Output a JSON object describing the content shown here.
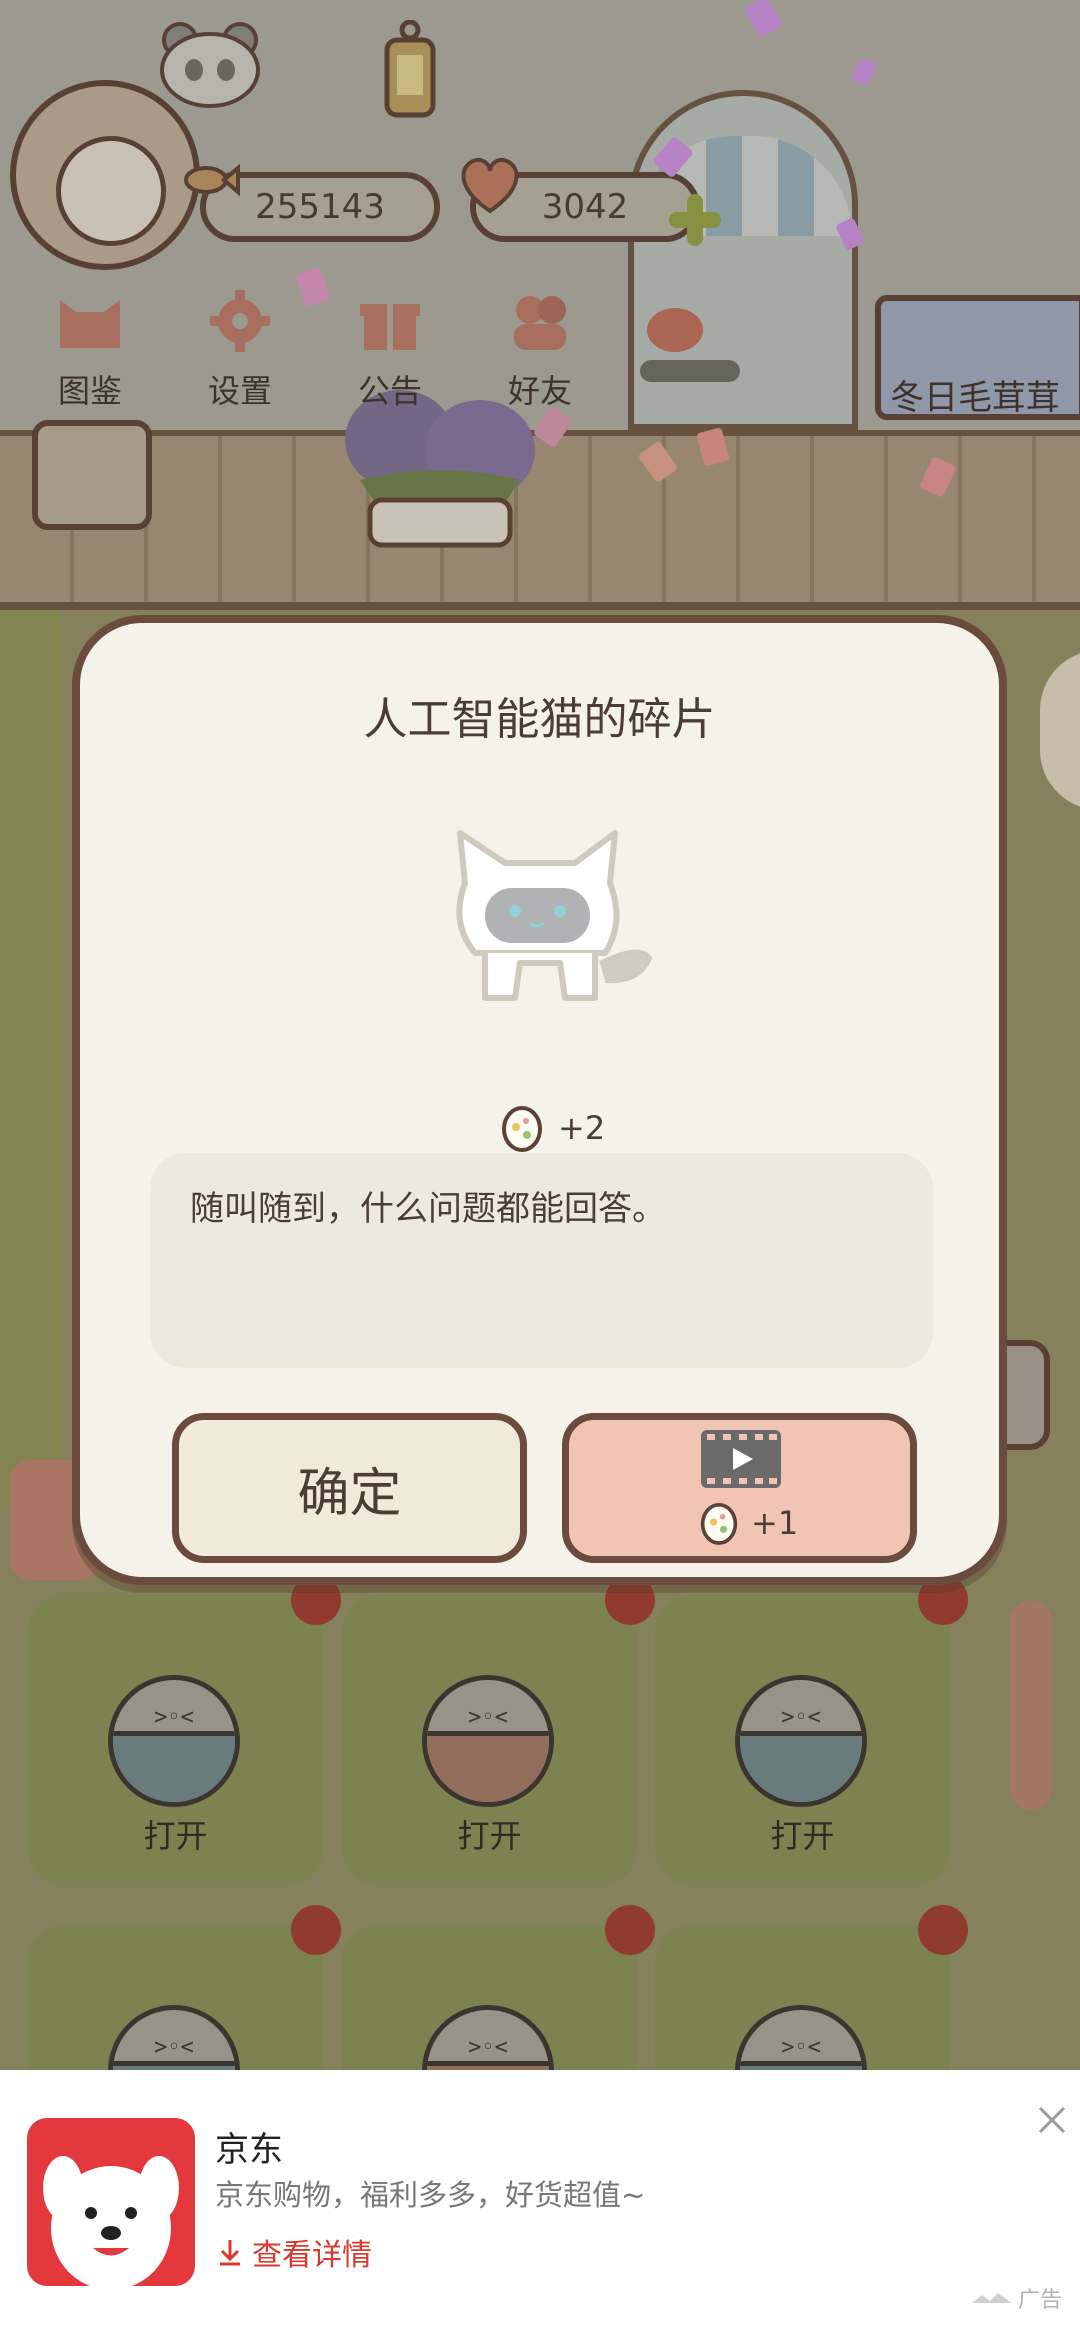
{
  "hud": {
    "fish_count": "255143",
    "heart_count": "3042",
    "banner_label": "冬日毛茸茸"
  },
  "menu": {
    "items": [
      {
        "label": "图鉴",
        "icon": "cat-head-icon"
      },
      {
        "label": "设置",
        "icon": "gear-icon"
      },
      {
        "label": "公告",
        "icon": "gift-icon"
      },
      {
        "label": "好友",
        "icon": "friends-icon"
      }
    ]
  },
  "capsules": {
    "row1": [
      {
        "label": "打开",
        "color": "#6f8387"
      },
      {
        "label": "打开",
        "color": "#9d7463"
      },
      {
        "label": "打开",
        "color": "#6f8387"
      }
    ]
  },
  "dialog": {
    "title": "人工智能猫的碎片",
    "reward": "+2",
    "description": "随叫随到，什么问题都能回答。",
    "confirm_label": "确定",
    "video_reward": "+1"
  },
  "ad": {
    "title": "京东",
    "subtitle": "京东购物，福利多多，好货超值~",
    "cta": "查看详情",
    "tag": "广告"
  },
  "colors": {
    "dialog_border": "#6a4b3c",
    "dialog_bg": "#f5f2ea",
    "video_button": "#f2c4b6",
    "confirm_button": "#f0ead9",
    "ad_red": "#e4393c"
  }
}
